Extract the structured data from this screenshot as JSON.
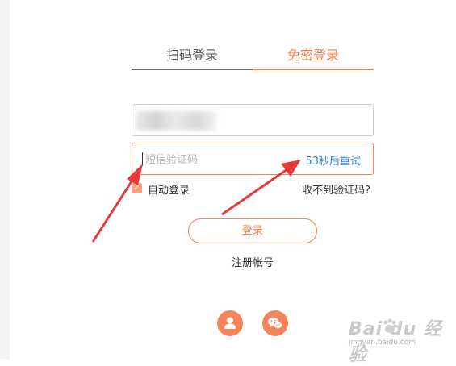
{
  "tabs": {
    "qr": "扫码登录",
    "sms": "免密登录"
  },
  "code_field": {
    "placeholder": "短信验证码",
    "resend": "53秒后重试"
  },
  "auto_login": {
    "label": "自动登录",
    "checked": true
  },
  "no_code_link": "收不到验证码?",
  "login_button": "登录",
  "register_link": "注册帐号",
  "social": [
    "account-icon",
    "wechat-icon"
  ],
  "colors": {
    "accent": "#f5804f",
    "link": "#2a7bd6",
    "arrow": "#e8393a"
  },
  "watermark": {
    "text": "Bai du 经验",
    "sub": "jingyan.baidu.com"
  }
}
